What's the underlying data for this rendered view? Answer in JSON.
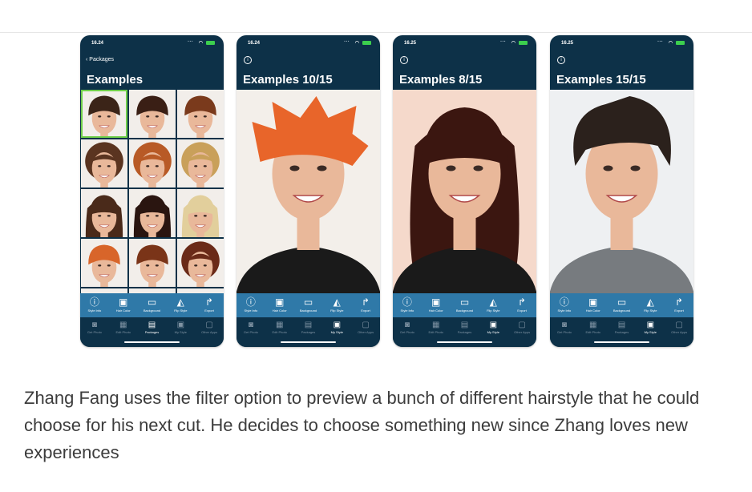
{
  "phones": [
    {
      "time": "16.24",
      "back_label": "Packages",
      "title": "Examples",
      "view": "grid",
      "thumbs": [
        {
          "hair": "#3b2418",
          "style": "short",
          "selected": true
        },
        {
          "hair": "#3a1f15",
          "style": "short"
        },
        {
          "hair": "#7a3a1c",
          "style": "short"
        },
        {
          "hair": "#5a3420",
          "style": "curly"
        },
        {
          "hair": "#b85a26",
          "style": "curly"
        },
        {
          "hair": "#c9a05a",
          "style": "curly"
        },
        {
          "hair": "#4a2a1a",
          "style": "long"
        },
        {
          "hair": "#2a1510",
          "style": "long"
        },
        {
          "hair": "#e2cf9c",
          "style": "long"
        },
        {
          "hair": "#d8652a",
          "style": "short"
        },
        {
          "hair": "#7a3418",
          "style": "short"
        },
        {
          "hair": "#6a2a18",
          "style": "curly"
        },
        {
          "hair": "#2a1a12",
          "style": "short"
        },
        {
          "hair": "#4a3528",
          "style": "short"
        },
        {
          "hair": "#2a2020",
          "style": "short"
        }
      ],
      "active_tab": 2
    },
    {
      "time": "16.24",
      "title": "Examples 10/15",
      "view": "photo",
      "hair": "#e8652a",
      "hair_style": "spiky",
      "bg": "#f3efea",
      "clothes": "#1a1a1a",
      "active_tab": 3
    },
    {
      "time": "16.25",
      "title": "Examples 8/15",
      "view": "photo",
      "hair": "#3b1610",
      "hair_style": "long",
      "bg": "#f5d9cb",
      "clothes": "#1a1a1a",
      "active_tab": 3
    },
    {
      "time": "16.25",
      "title": "Examples 15/15",
      "view": "photo",
      "hair": "#2b211c",
      "hair_style": "male",
      "bg": "#eef0f2",
      "clothes": "#777b7f",
      "active_tab": 3
    }
  ],
  "toolbar": [
    {
      "icon": "info-icon",
      "glyph": "ⓘ",
      "label": "Style Info"
    },
    {
      "icon": "hair-color-icon",
      "glyph": "▣",
      "label": "Hair Color"
    },
    {
      "icon": "background-icon",
      "glyph": "▭",
      "label": "Background"
    },
    {
      "icon": "flip-style-icon",
      "glyph": "◭",
      "label": "Flip Style"
    },
    {
      "icon": "export-icon",
      "glyph": "↱",
      "label": "Export"
    }
  ],
  "tabs": [
    {
      "icon": "camera-icon",
      "glyph": "◙",
      "label": "Get Photo"
    },
    {
      "icon": "edit-photo-icon",
      "glyph": "▦",
      "label": "Edit Photo"
    },
    {
      "icon": "packages-icon",
      "glyph": "▤",
      "label": "Packages"
    },
    {
      "icon": "my-style-icon",
      "glyph": "▣",
      "label": "My Style"
    },
    {
      "icon": "other-apps-icon",
      "glyph": "▢",
      "label": "Other Apps"
    }
  ],
  "caption": "Zhang Fang uses the filter option to preview a bunch of different hairstyle that he could choose for his next cut. He decides to choose something new since Zhang loves new experiences"
}
